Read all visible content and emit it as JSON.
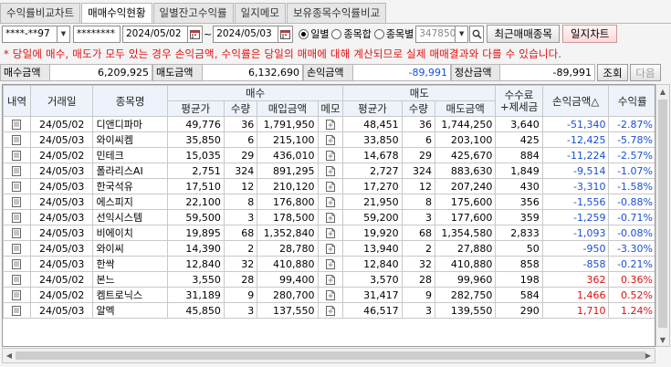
{
  "tabs": [
    {
      "label": "수익률비교차트",
      "active": false
    },
    {
      "label": "매매수익현황",
      "active": true
    },
    {
      "label": "일별잔고수익률",
      "active": false
    },
    {
      "label": "일지메모",
      "active": false
    },
    {
      "label": "보유종목수익률비교",
      "active": false
    }
  ],
  "toolbar": {
    "account": "****-**97",
    "password": "********",
    "start_date": "2024/05/02",
    "date_sep": "~",
    "end_date": "2024/05/03",
    "radio_daily": "일별",
    "radio_stock_sum": "종목합",
    "radio_by_stock": "종목별",
    "stock_code": "347850",
    "recent_trades_button": "최근매매종목",
    "journal_chart_button": "일지차트"
  },
  "notice": "* 당일에 매수, 매도가 모두 있는 경우 손익금액, 수익률은 당일의 매매에 대해 계산되므로 실제 매매결과와 다를 수 있습니다.",
  "summary": {
    "buy_label": "매수금액",
    "buy_value": "6,209,925",
    "sell_label": "매도금액",
    "sell_value": "6,132,690",
    "pnl_label": "손익금액",
    "pnl_value": "-89,991",
    "settle_label": "정산금액",
    "settle_value": "-89,991",
    "query_button": "조회",
    "next_button": "다음"
  },
  "table": {
    "headers": {
      "detail": "내역",
      "date": "거래일",
      "name": "종목명",
      "buy_group": "매수",
      "sell_group": "매도",
      "fee_line1": "수수료",
      "fee_line2": "+제세금",
      "pnl": "손익금액△",
      "rate": "수익률",
      "avg_price": "평균가",
      "qty": "수량",
      "amount_buy": "매입금액",
      "memo": "메모",
      "amount_sell": "매도금액"
    },
    "rows": [
      {
        "date": "24/05/02",
        "name": "디앤디파마",
        "b_avg": "49,776",
        "b_qty": "36",
        "b_amt": "1,791,950",
        "s_avg": "48,451",
        "s_qty": "36",
        "s_amt": "1,744,250",
        "fee": "3,640",
        "pnl": "-51,340",
        "rate": "-2.87%",
        "sign": "neg"
      },
      {
        "date": "24/05/03",
        "name": "와이씨켐",
        "b_avg": "35,850",
        "b_qty": "6",
        "b_amt": "215,100",
        "s_avg": "33,850",
        "s_qty": "6",
        "s_amt": "203,100",
        "fee": "425",
        "pnl": "-12,425",
        "rate": "-5.78%",
        "sign": "neg"
      },
      {
        "date": "24/05/02",
        "name": "민테크",
        "b_avg": "15,035",
        "b_qty": "29",
        "b_amt": "436,010",
        "s_avg": "14,678",
        "s_qty": "29",
        "s_amt": "425,670",
        "fee": "884",
        "pnl": "-11,224",
        "rate": "-2.57%",
        "sign": "neg"
      },
      {
        "date": "24/05/03",
        "name": "폴라리스AI",
        "b_avg": "2,751",
        "b_qty": "324",
        "b_amt": "891,295",
        "s_avg": "2,727",
        "s_qty": "324",
        "s_amt": "883,630",
        "fee": "1,849",
        "pnl": "-9,514",
        "rate": "-1.07%",
        "sign": "neg"
      },
      {
        "date": "24/05/03",
        "name": "한국석유",
        "b_avg": "17,510",
        "b_qty": "12",
        "b_amt": "210,120",
        "s_avg": "17,270",
        "s_qty": "12",
        "s_amt": "207,240",
        "fee": "430",
        "pnl": "-3,310",
        "rate": "-1.58%",
        "sign": "neg"
      },
      {
        "date": "24/05/03",
        "name": "에스피지",
        "b_avg": "22,100",
        "b_qty": "8",
        "b_amt": "176,800",
        "s_avg": "21,950",
        "s_qty": "8",
        "s_amt": "175,600",
        "fee": "356",
        "pnl": "-1,556",
        "rate": "-0.88%",
        "sign": "neg"
      },
      {
        "date": "24/05/03",
        "name": "선익시스템",
        "b_avg": "59,500",
        "b_qty": "3",
        "b_amt": "178,500",
        "s_avg": "59,200",
        "s_qty": "3",
        "s_amt": "177,600",
        "fee": "359",
        "pnl": "-1,259",
        "rate": "-0.71%",
        "sign": "neg"
      },
      {
        "date": "24/05/03",
        "name": "비에이치",
        "b_avg": "19,895",
        "b_qty": "68",
        "b_amt": "1,352,840",
        "s_avg": "19,920",
        "s_qty": "68",
        "s_amt": "1,354,580",
        "fee": "2,833",
        "pnl": "-1,093",
        "rate": "-0.08%",
        "sign": "neg"
      },
      {
        "date": "24/05/03",
        "name": "와이씨",
        "b_avg": "14,390",
        "b_qty": "2",
        "b_amt": "28,780",
        "s_avg": "13,940",
        "s_qty": "2",
        "s_amt": "27,880",
        "fee": "50",
        "pnl": "-950",
        "rate": "-3.30%",
        "sign": "neg"
      },
      {
        "date": "24/05/03",
        "name": "한싹",
        "b_avg": "12,840",
        "b_qty": "32",
        "b_amt": "410,880",
        "s_avg": "12,840",
        "s_qty": "32",
        "s_amt": "410,880",
        "fee": "858",
        "pnl": "-858",
        "rate": "-0.21%",
        "sign": "neg"
      },
      {
        "date": "24/05/02",
        "name": "본느",
        "b_avg": "3,550",
        "b_qty": "28",
        "b_amt": "99,400",
        "s_avg": "3,570",
        "s_qty": "28",
        "s_amt": "99,960",
        "fee": "198",
        "pnl": "362",
        "rate": "0.36%",
        "sign": "pos"
      },
      {
        "date": "24/05/02",
        "name": "켐트로닉스",
        "b_avg": "31,189",
        "b_qty": "9",
        "b_amt": "280,700",
        "s_avg": "31,417",
        "s_qty": "9",
        "s_amt": "282,750",
        "fee": "584",
        "pnl": "1,466",
        "rate": "0.52%",
        "sign": "pos"
      },
      {
        "date": "24/05/03",
        "name": "알멕",
        "b_avg": "45,850",
        "b_qty": "3",
        "b_amt": "137,550",
        "s_avg": "46,517",
        "s_qty": "3",
        "s_amt": "139,550",
        "fee": "290",
        "pnl": "1,710",
        "rate": "1.24%",
        "sign": "pos"
      }
    ]
  },
  "icons": {
    "detail": "document-icon",
    "memo": "memo-icon",
    "calendar": "calendar-icon",
    "search": "search-icon"
  },
  "colors": {
    "negative": "#1a4fd6",
    "positive": "#e01010",
    "header_bg": "#eef3fb",
    "notice": "#e01010"
  }
}
